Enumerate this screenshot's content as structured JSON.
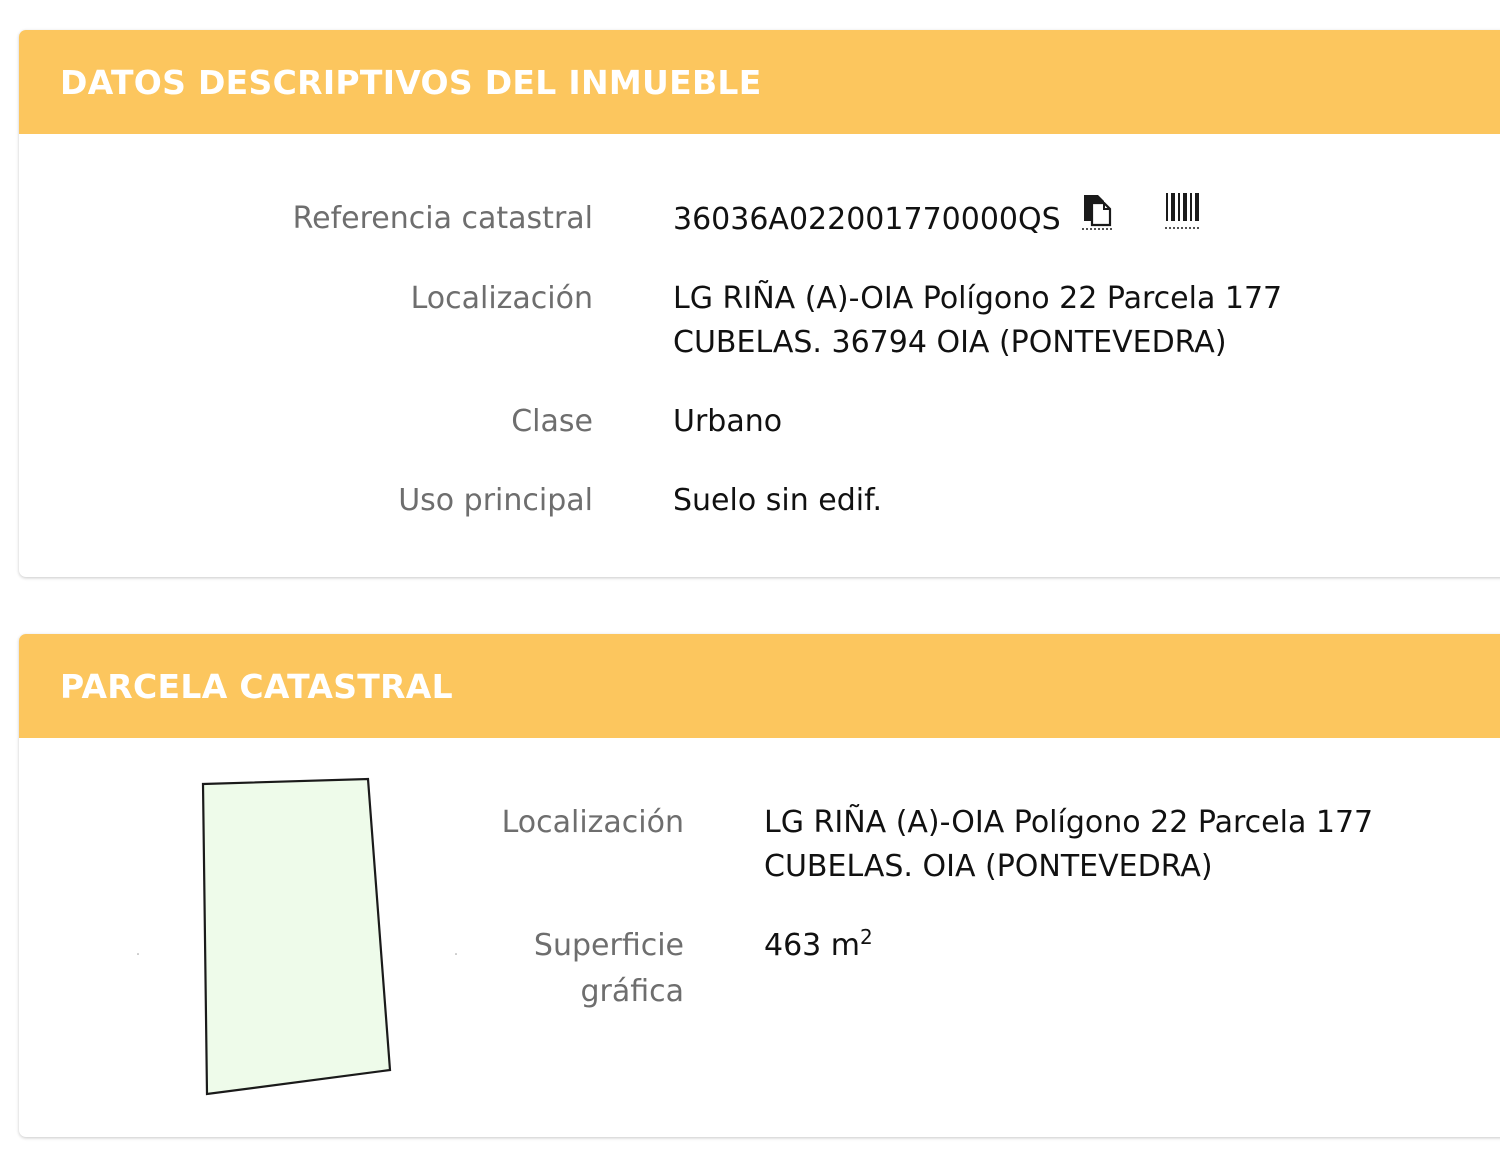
{
  "colors": {
    "header_bg": "#fcc65e",
    "header_text": "#ffffff",
    "label_text": "#6e6e6e",
    "value_text": "#111111",
    "parcel_fill": "#eefbea",
    "parcel_stroke": "#1a1a1a"
  },
  "inmueble": {
    "title": "DATOS DESCRIPTIVOS DEL INMUEBLE",
    "referencia": {
      "label": "Referencia catastral",
      "value": "36036A022001770000QS",
      "icons": [
        "copy-icon",
        "barcode-icon"
      ]
    },
    "localizacion": {
      "label": "Localización",
      "line1": "LG RIÑA (A)-OIA Polígono 22 Parcela 177",
      "line2": "CUBELAS. 36794 OIA (PONTEVEDRA)"
    },
    "clase": {
      "label": "Clase",
      "value": "Urbano"
    },
    "uso": {
      "label": "Uso principal",
      "value": "Suelo sin edif."
    }
  },
  "parcela": {
    "title": "PARCELA CATASTRAL",
    "localizacion": {
      "label": "Localización",
      "line1": "LG RIÑA (A)-OIA Polígono 22 Parcela 177",
      "line2": "CUBELAS. OIA (PONTEVEDRA)"
    },
    "superficie": {
      "label_line1": "Superficie",
      "label_line2": "gráfica",
      "value": "463 m",
      "unit_exponent": "2"
    }
  }
}
